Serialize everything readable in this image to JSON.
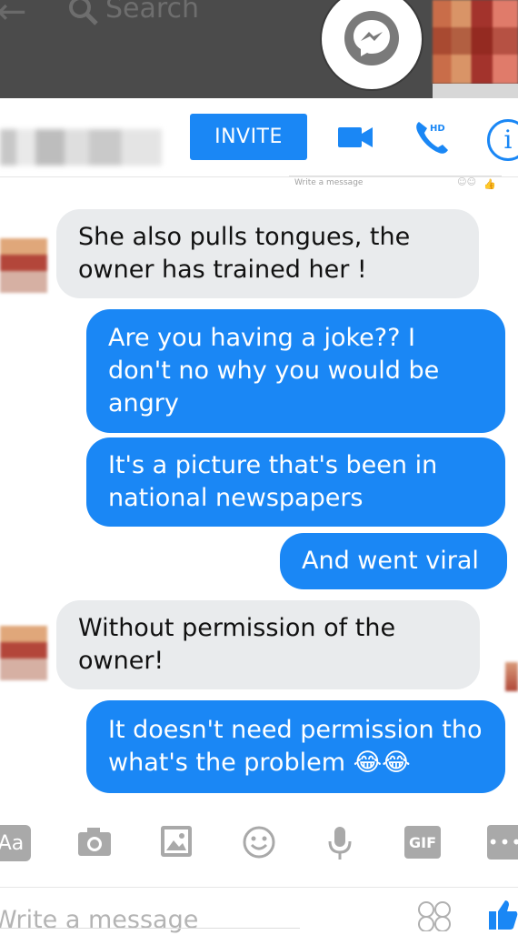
{
  "app": {
    "search_placeholder": "Search",
    "accent_color": "#1a87f5",
    "icons": [
      "back-arrow-icon",
      "search-icon",
      "messenger-icon",
      "video-call-icon",
      "hd-call-icon",
      "info-icon"
    ]
  },
  "header": {
    "invite_label": "INVITE",
    "call_badge": "HD",
    "info_glyph": "i"
  },
  "mini_compose": {
    "placeholder": "Write a message"
  },
  "messages": [
    {
      "direction": "incoming",
      "text": "She also pulls tongues, the owner has trained her !"
    },
    {
      "direction": "outgoing",
      "text": "Are you having a joke?? I don't no why you would be angry"
    },
    {
      "direction": "outgoing",
      "text": "It's a picture that's been in national newspapers"
    },
    {
      "direction": "outgoing",
      "text": "And went viral"
    },
    {
      "direction": "incoming",
      "text": "Without permission of the owner!"
    },
    {
      "direction": "outgoing",
      "text": "It doesn't need permission tho what's the problem 😂😂"
    }
  ],
  "toolbar": {
    "aa_label": "Aa",
    "gif_label": "GIF",
    "more_label": "•••",
    "icons": [
      "text-format-icon",
      "camera-icon",
      "gallery-icon",
      "emoji-icon",
      "microphone-icon",
      "gif-icon",
      "more-icon"
    ]
  },
  "compose": {
    "placeholder": "Write a message"
  }
}
